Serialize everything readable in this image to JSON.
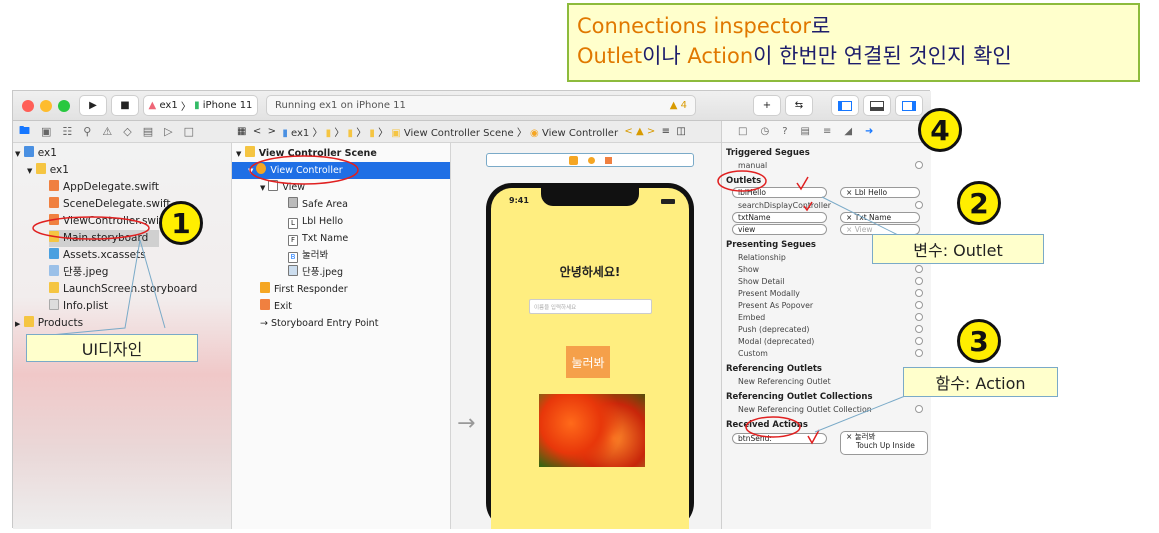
{
  "annotation": {
    "line1_term": "Connections inspector",
    "line1_suffix": "로",
    "line2_term1": "Outlet",
    "line2_mid": "이나 ",
    "line2_term2": "Action",
    "line2_suffix": "이 한번만 연결된 것인지 확인"
  },
  "toolbar": {
    "scheme_name": "ex1",
    "device": "iPhone 11",
    "status": "Running ex1 on iPhone 11",
    "warning_count": "4"
  },
  "navigator": {
    "items": [
      {
        "label": "ex1",
        "level": 0,
        "icon": "project-icon"
      },
      {
        "label": "ex1",
        "level": 1,
        "icon": "folder-icon"
      },
      {
        "label": "AppDelegate.swift",
        "level": 2,
        "icon": "swift-file-icon"
      },
      {
        "label": "SceneDelegate.swift",
        "level": 2,
        "icon": "swift-file-icon"
      },
      {
        "label": "ViewController.swift",
        "level": 2,
        "icon": "swift-file-icon"
      },
      {
        "label": "Main.storyboard",
        "level": 2,
        "icon": "storyboard-icon"
      },
      {
        "label": "Assets.xcassets",
        "level": 2,
        "icon": "assets-icon"
      },
      {
        "label": "단풍.jpeg",
        "level": 2,
        "icon": "image-file-icon"
      },
      {
        "label": "LaunchScreen.storyboard",
        "level": 2,
        "icon": "storyboard-icon"
      },
      {
        "label": "Info.plist",
        "level": 2,
        "icon": "plist-icon"
      },
      {
        "label": "Products",
        "level": 0,
        "icon": "folder-icon"
      }
    ]
  },
  "jumpbar": {
    "path": [
      "ex1",
      "View Controller Scene",
      "View Controller"
    ]
  },
  "outline": {
    "items": [
      {
        "label": "View Controller Scene",
        "level": 0
      },
      {
        "label": "View Controller",
        "level": 1
      },
      {
        "label": "View",
        "level": 2
      },
      {
        "label": "Safe Area",
        "level": 3
      },
      {
        "label": "Lbl Hello",
        "level": 3
      },
      {
        "label": "Txt Name",
        "level": 3
      },
      {
        "label": "눌러봐",
        "level": 3
      },
      {
        "label": "단풍.jpeg",
        "level": 3
      },
      {
        "label": "First Responder",
        "level": 1
      },
      {
        "label": "Exit",
        "level": 1
      },
      {
        "label": "Storyboard Entry Point",
        "level": 1
      }
    ]
  },
  "phone": {
    "time": "9:41",
    "greeting": "안녕하세요!",
    "placeholder": "이름을 입력하세요",
    "button_label": "눌러봐"
  },
  "inspector": {
    "triggered_segues_header": "Triggered Segues",
    "manual_label": "manual",
    "outlets_header": "Outlets",
    "outlets": [
      {
        "name": "lblHello",
        "target": "Lbl Hello"
      },
      {
        "name": "searchDisplayController",
        "target": ""
      },
      {
        "name": "txtName",
        "target": "Txt Name"
      },
      {
        "name": "view",
        "target": "View"
      }
    ],
    "presenting_segues_header": "Presenting Segues",
    "presenting_segues": [
      "Relationship",
      "Show",
      "Show Detail",
      "Present Modally",
      "Present As Popover",
      "Embed",
      "Push (deprecated)",
      "Modal (deprecated)",
      "Custom"
    ],
    "ref_outlets_header": "Referencing Outlets",
    "new_ref_outlet": "New Referencing Outlet",
    "ref_collections_header": "Referencing Outlet Collections",
    "new_ref_collection": "New Referencing Outlet Collection",
    "received_actions_header": "Received Actions",
    "action_name": "btnSend:",
    "action_target": "눌러봐",
    "action_event": "Touch Up Inside"
  },
  "callouts": {
    "ui_design": "UI디자인",
    "variable_outlet": "변수: Outlet",
    "function_action": "함수: Action"
  },
  "markers": {
    "one": "1",
    "two": "2",
    "three": "3",
    "four": "4"
  }
}
